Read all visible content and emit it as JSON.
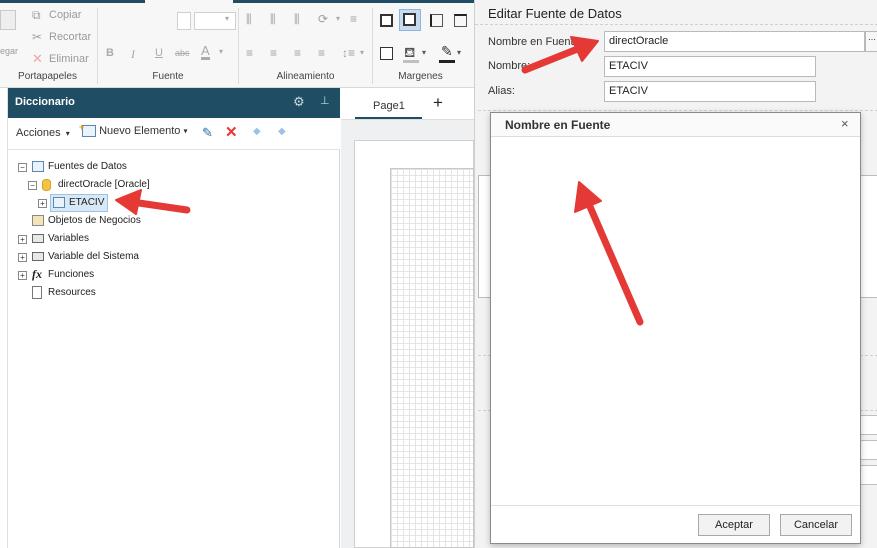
{
  "ribbon": {
    "clipboard": {
      "paste_label": "egar",
      "copy_label": "Copiar",
      "cut_label": "Recortar",
      "delete_label": "Eliminar",
      "group_label": "Portapapeles"
    },
    "font": {
      "group_label": "Fuente"
    },
    "alignment": {
      "group_label": "Alineamiento"
    },
    "margins": {
      "group_label": "Margenes"
    }
  },
  "dictionary": {
    "title": "Diccionario",
    "actions_label": "Acciones",
    "new_item_label": "Nuevo Elemento",
    "tree": {
      "data_sources": "Fuentes de Datos",
      "connection": "directOracle [Oracle]",
      "table": "ETACIV",
      "business_objects": "Objetos de Negocios",
      "variables": "Variables",
      "system_variables": "Variable del Sistema",
      "functions": "Funciones",
      "resources": "Resources"
    }
  },
  "canvas": {
    "page_tab": "Page1",
    "add_tab": "+"
  },
  "edit_source": {
    "title": "Editar Fuente de Datos",
    "name_in_source_label": "Nombre en Fuente:",
    "name_in_source_value": "directOracle",
    "browse_label": "...",
    "name_label": "Nombre:",
    "name_value": "ETACIV",
    "alias_label": "Alias:",
    "alias_value": "ETACIV"
  },
  "modal": {
    "title": "Nombre en Fuente",
    "close": "×",
    "accept_label": "Aceptar",
    "cancel_label": "Cancelar"
  },
  "colors": {
    "dark_teal": "#1f4e64",
    "arrow_red": "#e53935"
  }
}
